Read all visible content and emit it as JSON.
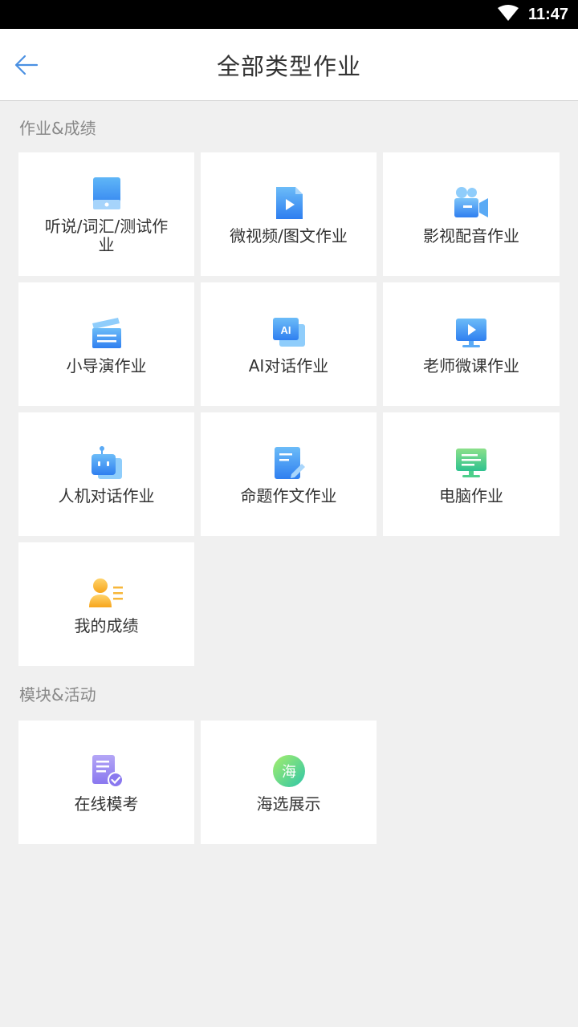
{
  "status_bar": {
    "time": "11:47"
  },
  "header": {
    "title": "全部类型作业"
  },
  "sections": [
    {
      "title": "作业&成绩",
      "items": [
        {
          "label": "听说/词汇/测试作业",
          "icon": "tablet-icon"
        },
        {
          "label": "微视频/图文作业",
          "icon": "video-file-icon"
        },
        {
          "label": "影视配音作业",
          "icon": "video-camera-icon"
        },
        {
          "label": "小导演作业",
          "icon": "clapperboard-icon"
        },
        {
          "label": "AI对话作业",
          "icon": "ai-chat-icon"
        },
        {
          "label": "老师微课作业",
          "icon": "screen-play-icon"
        },
        {
          "label": "人机对话作业",
          "icon": "robot-icon"
        },
        {
          "label": "命题作文作业",
          "icon": "edit-document-icon"
        },
        {
          "label": "电脑作业",
          "icon": "computer-icon"
        },
        {
          "label": "我的成绩",
          "icon": "user-report-icon"
        }
      ]
    },
    {
      "title": "模块&活动",
      "items": [
        {
          "label": "在线模考",
          "icon": "exam-check-icon"
        },
        {
          "label": "海选展示",
          "icon": "hai-badge-icon",
          "glyph": "海"
        }
      ]
    }
  ],
  "colors": {
    "accent": "#4a90e2",
    "background": "#f0f0f0"
  }
}
